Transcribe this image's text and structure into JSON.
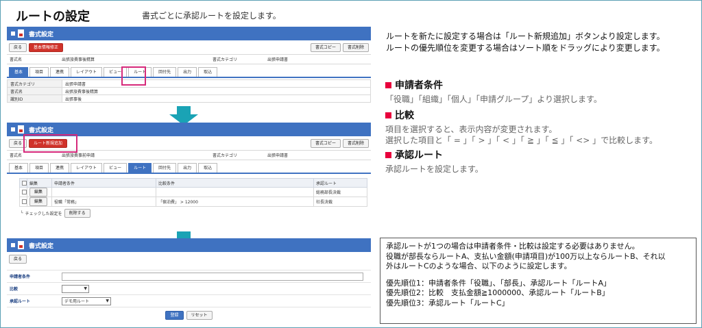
{
  "title": "ルートの設定",
  "subtitle": "書式ごとに承認ルートを設定します。",
  "panel1": {
    "header": "書式設定",
    "back_label": "戻る",
    "edit_basic_label": "基本情報修正",
    "copy_label": "書式コピー",
    "delete_label": "書式削除",
    "info": {
      "format_name_label": "書式名",
      "format_name_value": "出張旅費事後精算",
      "category_label": "書式カテゴリ",
      "category_value": "出張申請書"
    },
    "tabs": [
      "基本",
      "項目",
      "連携",
      "レイアウト",
      "ビュー",
      "ルート",
      "回付先",
      "出力",
      "取込"
    ],
    "details": [
      {
        "k": "書式カテゴリ",
        "v": "出張申請書"
      },
      {
        "k": "書式名",
        "v": "出張旅費事後精算"
      },
      {
        "k": "識別ID",
        "v": "出張事後"
      }
    ]
  },
  "panel2": {
    "header": "書式設定",
    "back_label": "戻る",
    "add_route_label": "ルート新規追加",
    "copy_label": "書式コピー",
    "delete_label": "書式削除",
    "info": {
      "format_name_label": "書式名",
      "format_name_value": "出張旅費事前申請",
      "category_label": "書式カテゴリ",
      "category_value": "出張申請書"
    },
    "tabs": [
      "基本",
      "項目",
      "連携",
      "レイアウト",
      "ビュー",
      "ルート",
      "回付先",
      "出力",
      "取込"
    ],
    "columns": [
      "編集",
      "申請者条件",
      "比較条件",
      "承認ルート"
    ],
    "rows": [
      {
        "edit": "編集",
        "applicant": "",
        "compare": "",
        "route": "総務部長決裁"
      },
      {
        "edit": "編集",
        "applicant": "役職「常務」",
        "compare": "「宿泊費」 > 12000",
        "route": "社長決裁"
      }
    ],
    "checked_label": "チェックした設定を",
    "bulk_delete_label": "削除する"
  },
  "panel3": {
    "header": "書式設定",
    "back_label": "戻る",
    "applicant_label": "申請者条件",
    "compare_label": "比較",
    "route_label": "承認ルート",
    "route_value": "デモ用ルート",
    "register_label": "登録",
    "reset_label": "リセット"
  },
  "right": {
    "intro_line1": "ルートを新たに設定する場合は「ルート新規追加」ボタンより設定します。",
    "intro_line2": "ルートの優先順位を変更する場合はソート順をドラッグにより変更します。",
    "sec1_title": "申請者条件",
    "sec1_text": "「役職」「組織」「個人」「申請グループ」より選択します。",
    "sec2_title": "比較",
    "sec2_text1": "項目を選択すると、表示内容が変更されます。",
    "sec2_text2": "選択した項目と「 = 」「 > 」「 < 」「 ≧ 」「 ≦ 」「 <> 」で比較します。",
    "sec3_title": "承認ルート",
    "sec3_text": "承認ルートを設定します。"
  },
  "note": {
    "line1": "承認ルートが1つの場合は申請者条件・比較は設定する必要はありません。",
    "line2": "役職が部長ならルートA、支払い金額(申請項目)が100万以上ならルートB、それ以",
    "line3": "外はルートCのような場合、以下のように設定します。",
    "line4": "優先順位1：申請者条件「役職」、「部長」、承認ルート「ルートA」",
    "line5": "優先順位2：比較　支払金額≧1000000、承認ルート「ルートB」",
    "line6": "優先順位3：承認ルート「ルートC」"
  },
  "colors": {
    "header_blue": "#3f72c1",
    "button_red": "#d0322a",
    "highlight": "#d6287a",
    "arrow": "#1aa3b5",
    "bullet": "#e8003c"
  }
}
